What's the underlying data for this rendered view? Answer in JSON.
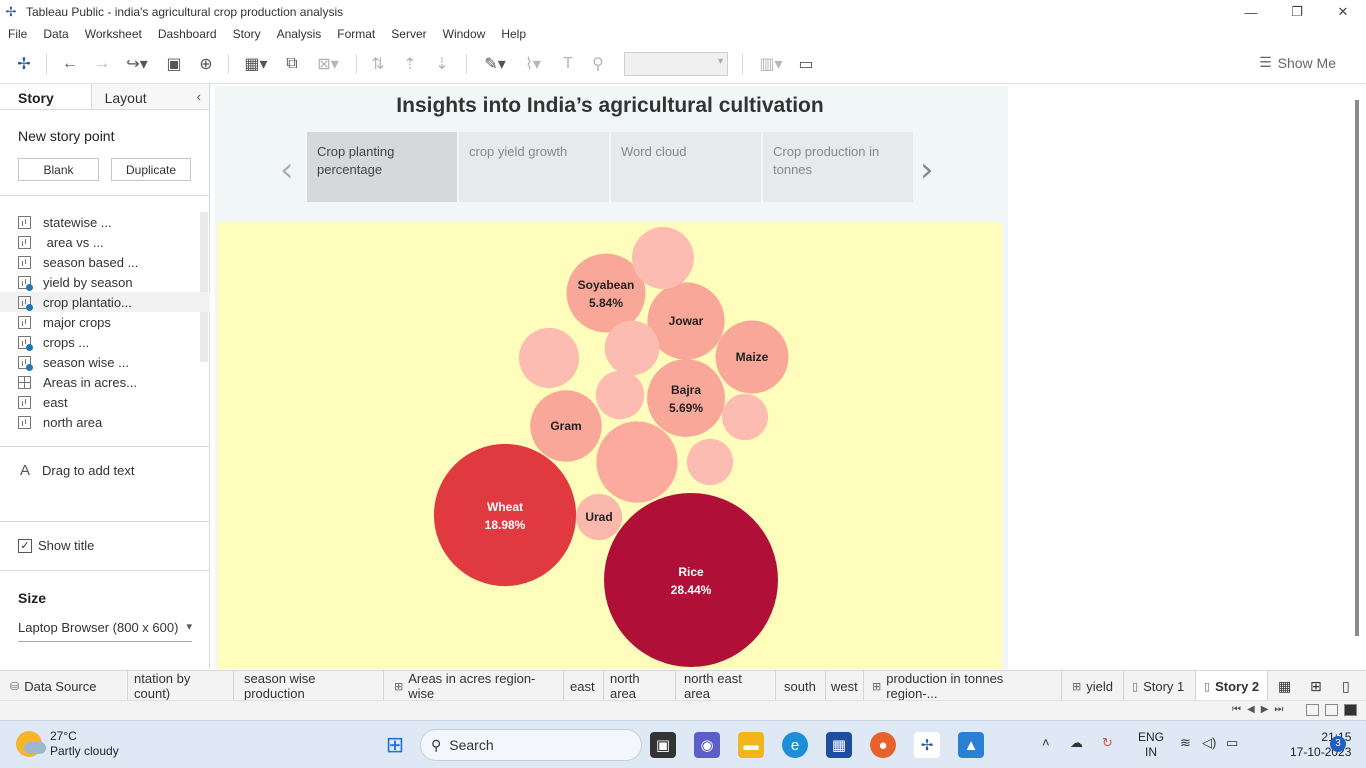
{
  "window": {
    "title": "Tableau Public - india's agricultural crop production analysis"
  },
  "menu": [
    "File",
    "Data",
    "Worksheet",
    "Dashboard",
    "Story",
    "Analysis",
    "Format",
    "Server",
    "Window",
    "Help"
  ],
  "toolbar": {
    "show_me": "Show Me"
  },
  "left_pane": {
    "tab_story": "Story",
    "tab_layout": "Layout",
    "new_story_point": "New story point",
    "blank_button": "Blank",
    "duplicate_button": "Duplicate",
    "sheets": [
      {
        "label": "statewise ...",
        "icon": "bar-chart-icon",
        "check": false
      },
      {
        "label": " area vs ...",
        "icon": "bar-chart-icon",
        "check": false
      },
      {
        "label": "season based ...",
        "icon": "bar-chart-icon",
        "check": false
      },
      {
        "label": "yield by season",
        "icon": "bar-chart-icon",
        "check": true
      },
      {
        "label": "crop plantatio...",
        "icon": "bar-chart-icon",
        "check": true
      },
      {
        "label": "major crops",
        "icon": "bar-chart-icon",
        "check": false
      },
      {
        "label": "crops ...",
        "icon": "bar-chart-icon",
        "check": true
      },
      {
        "label": "season wise ...",
        "icon": "bar-chart-icon",
        "check": true
      },
      {
        "label": "Areas in acres...",
        "icon": "dashboard-icon",
        "check": false
      },
      {
        "label": "east",
        "icon": "bar-chart-icon",
        "check": false
      },
      {
        "label": "north area",
        "icon": "bar-chart-icon",
        "check": false
      }
    ],
    "drag_text": "Drag to add text",
    "show_title": "Show title",
    "size_header": "Size",
    "size_value": "Laptop Browser (800 x 600)"
  },
  "story": {
    "title": "Insights into India’s agricultural cultivation",
    "points": [
      {
        "label": "Crop planting percentage",
        "active": true
      },
      {
        "label": "crop yield growth",
        "active": false
      },
      {
        "label": "Word cloud",
        "active": false
      },
      {
        "label": "Crop production in tonnes",
        "active": false
      }
    ]
  },
  "chart_data": {
    "type": "bubble",
    "title": "",
    "bubbles": [
      {
        "label": "Rice",
        "pct": "28.44%",
        "value": 28.44,
        "color": "#b01038"
      },
      {
        "label": "Wheat",
        "pct": "18.98%",
        "value": 18.98,
        "color": "#e0393f"
      },
      {
        "label": "Soyabean",
        "pct": "5.84%",
        "value": 5.84,
        "color": "#f9a798"
      },
      {
        "label": "Bajra",
        "pct": "5.69%",
        "value": 5.69,
        "color": "#f9a798"
      },
      {
        "label": "Jowar",
        "pct": "",
        "value": 5.6,
        "color": "#f9a798"
      },
      {
        "label": "Maize",
        "pct": "",
        "value": 5.0,
        "color": "#f9a798"
      },
      {
        "label": "Gram",
        "pct": "",
        "value": 4.8,
        "color": "#f9a798"
      },
      {
        "label": "Urad",
        "pct": "",
        "value": 2.0,
        "color": "#fbb8ad"
      },
      {
        "label": "",
        "pct": "",
        "value": 6.2,
        "color": "#fbaa9d"
      },
      {
        "label": "",
        "pct": "",
        "value": 3.6,
        "color": "#fcbcb1"
      },
      {
        "label": "",
        "pct": "",
        "value": 3.4,
        "color": "#fcbcb1"
      },
      {
        "label": "",
        "pct": "",
        "value": 2.8,
        "color": "#fcbcb1"
      },
      {
        "label": "",
        "pct": "",
        "value": 2.2,
        "color": "#fcbcb1"
      },
      {
        "label": "",
        "pct": "",
        "value": 2.0,
        "color": "#fcbcb1"
      },
      {
        "label": "",
        "pct": "",
        "value": 2.0,
        "color": "#fcbcb1"
      }
    ],
    "background": "#fefdbb"
  },
  "sheet_tabs": [
    {
      "label": "Data Source",
      "icon": "datasource-icon"
    },
    {
      "label": "ntation by count)",
      "icon": ""
    },
    {
      "label": "season wise production",
      "icon": ""
    },
    {
      "label": "Areas in acres region-wise",
      "icon": "dashboard-icon"
    },
    {
      "label": "east",
      "icon": ""
    },
    {
      "label": "north area",
      "icon": ""
    },
    {
      "label": "north east area",
      "icon": ""
    },
    {
      "label": "south",
      "icon": ""
    },
    {
      "label": "west",
      "icon": ""
    },
    {
      "label": "production in tonnes region-...",
      "icon": "dashboard-icon"
    },
    {
      "label": "yield",
      "icon": "dashboard-icon"
    },
    {
      "label": "Story 1",
      "icon": "story-icon"
    },
    {
      "label": "Story 2",
      "icon": "story-icon",
      "active": true
    }
  ],
  "taskbar": {
    "temp": "27°C",
    "weather": "Partly cloudy",
    "search": "Search",
    "lang1": "ENG",
    "lang2": "IN",
    "time": "21:15",
    "date": "17-10-2023",
    "notifications": "3"
  }
}
